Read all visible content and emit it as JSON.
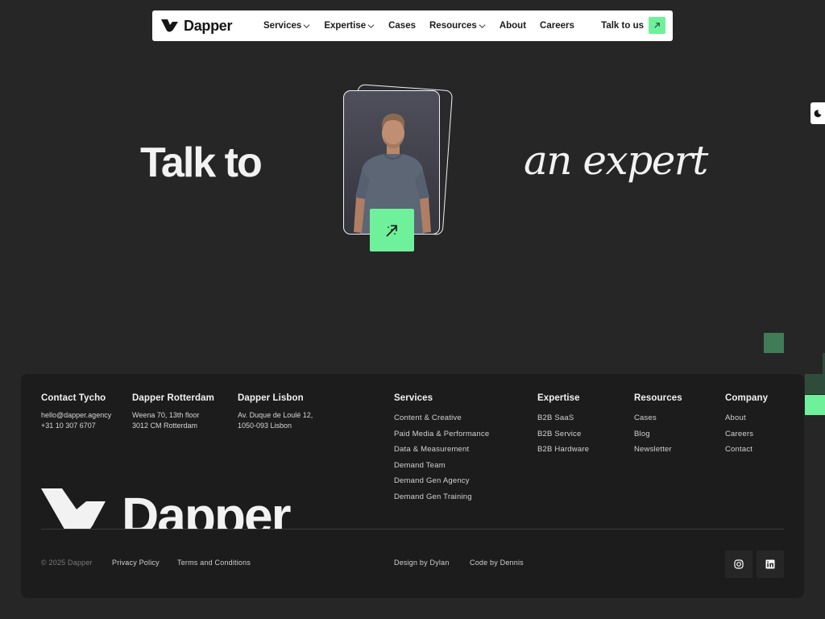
{
  "nav": {
    "brand": "Dapper",
    "items": [
      {
        "label": "Services",
        "dropdown": true
      },
      {
        "label": "Expertise",
        "dropdown": true
      },
      {
        "label": "Cases",
        "dropdown": false
      },
      {
        "label": "Resources",
        "dropdown": true
      },
      {
        "label": "About",
        "dropdown": false
      },
      {
        "label": "Careers",
        "dropdown": false
      }
    ],
    "cta_label": "Talk to us"
  },
  "hero": {
    "left_text": "Talk to",
    "right_text": "an expert"
  },
  "footer": {
    "contacts": [
      {
        "title": "Contact Tycho",
        "lines": [
          "hello@dapper.agency",
          "+31 10 307 6707"
        ]
      },
      {
        "title": "Dapper Rotterdam",
        "lines": [
          "Weena 70, 13th floor",
          "3012 CM Rotterdam"
        ]
      },
      {
        "title": "Dapper Lisbon",
        "lines": [
          "Av. Duque de Loulé 12,",
          "1050-093 Lisbon"
        ]
      }
    ],
    "services": {
      "title": "Services",
      "links": [
        "Content & Creative",
        "Paid Media & Performance",
        "Data & Measurement",
        "Demand Team",
        "Demand Gen Agency",
        "Demand Gen Training"
      ]
    },
    "expertise": {
      "title": "Expertise",
      "links": [
        "B2B SaaS",
        "B2B Service",
        "B2B Hardware"
      ]
    },
    "resources": {
      "title": "Resources",
      "links": [
        "Cases",
        "Blog",
        "Newsletter"
      ]
    },
    "company": {
      "title": "Company",
      "links": [
        "About",
        "Careers",
        "Contact"
      ]
    },
    "big_brand": "Dapper",
    "copyright": "© 2025 Dapper",
    "privacy": "Privacy Policy",
    "terms": "Terms and Conditions",
    "design_credit": "Design by Dylan",
    "code_credit": "Code by Dennis"
  },
  "colors": {
    "accent": "#6ff09b",
    "page_bg": "#262626",
    "footer_bg": "#1c1c1c"
  }
}
